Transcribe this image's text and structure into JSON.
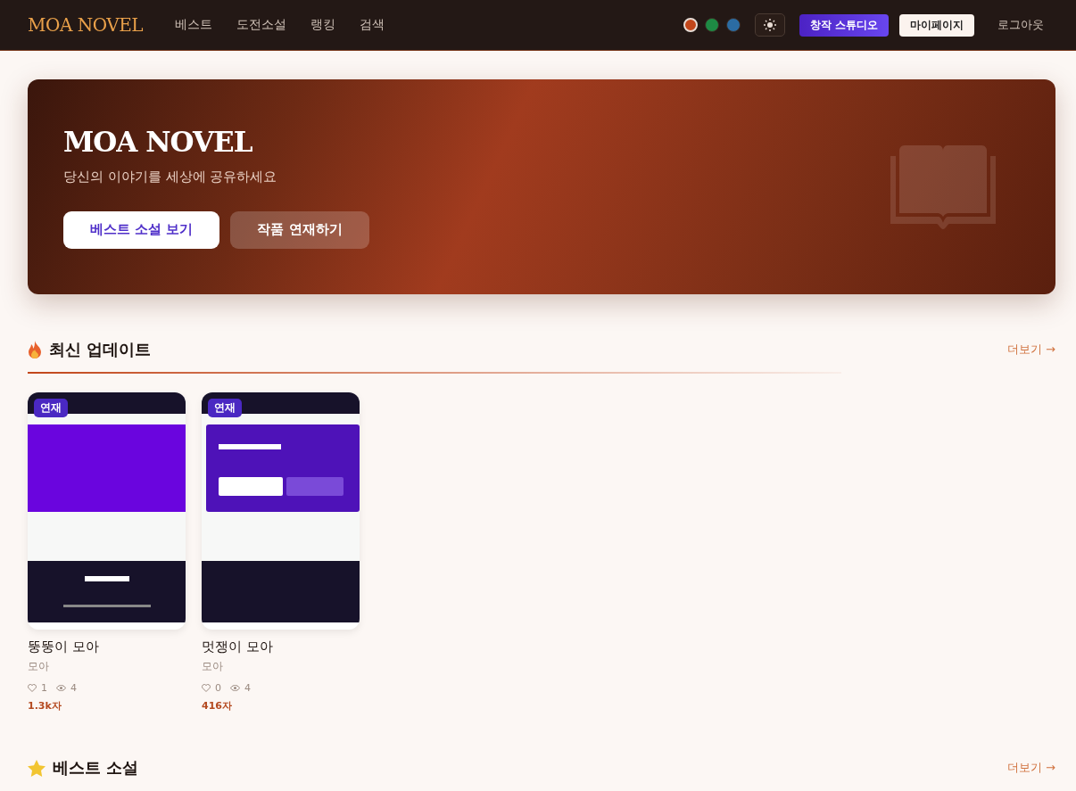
{
  "header": {
    "logo": "MOA NOVEL",
    "nav": [
      "베스트",
      "도전소설",
      "랭킹",
      "검색"
    ],
    "themes": [
      {
        "color": "#c2461a",
        "selected": true
      },
      {
        "color": "#1e8a44",
        "selected": false
      },
      {
        "color": "#2b6ca3",
        "selected": false
      }
    ],
    "studio_button": "창작 스튜디오",
    "mypage_button": "마이페이지",
    "logout": "로그아웃"
  },
  "hero": {
    "title": "MOA NOVEL",
    "subtitle": "당신의 이야기를 세상에 공유하세요",
    "buttons": [
      "베스트 소설 보기",
      "작품 연재하기"
    ]
  },
  "sections": [
    {
      "kind": "fire",
      "title": "최신 업데이트",
      "more": "더보기 →",
      "novels": [
        {
          "badge": "연재",
          "title": "뚱뚱이 모아",
          "author": "모아",
          "likes": "1",
          "views": "4",
          "length": "1.3k자"
        },
        {
          "badge": "연재",
          "title": "멋쟁이 모아",
          "author": "모아",
          "likes": "0",
          "views": "4",
          "length": "416자"
        }
      ]
    },
    {
      "kind": "star",
      "title": "베스트 소설",
      "more": "더보기 →"
    }
  ]
}
